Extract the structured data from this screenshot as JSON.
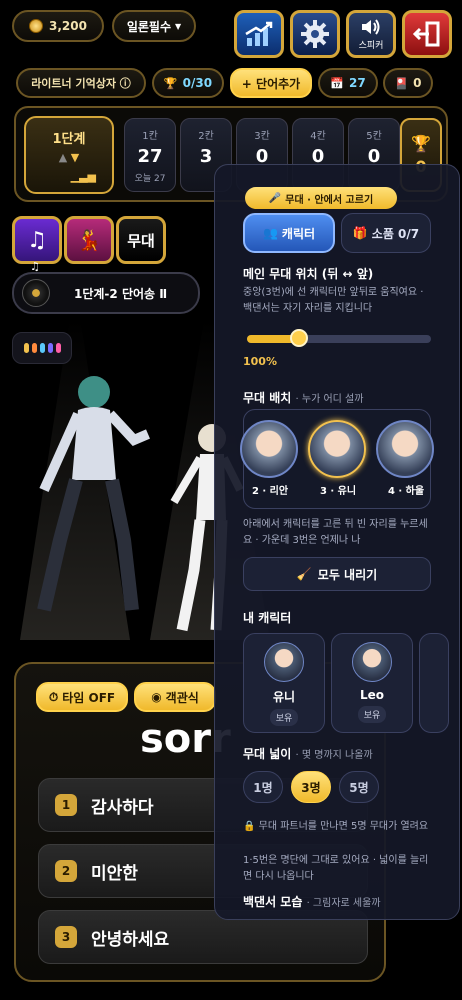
{
  "topbar": {
    "coins": "3,200",
    "mode": "일론필수",
    "speaker_label": "스피커"
  },
  "row2": {
    "memory_box": "라이트너 기억상자 ⓘ",
    "trophy_progress": "0/30",
    "add_word": "+ 단어추가",
    "calendar_count": "27",
    "cards_count": "0"
  },
  "level": {
    "title": "1단계",
    "cells": [
      {
        "head": "1칸",
        "value": "27",
        "sub": "오늘 27"
      },
      {
        "head": "2칸",
        "value": "3",
        "sub": ""
      },
      {
        "head": "3칸",
        "value": "0",
        "sub": ""
      },
      {
        "head": "4칸",
        "value": "0",
        "sub": ""
      },
      {
        "head": "5칸",
        "value": "0",
        "sub": ""
      }
    ],
    "trophy_value": "0"
  },
  "left_buttons": {
    "stage": "무대"
  },
  "song": {
    "name": "1단계-2 단어송 Ⅱ"
  },
  "quiz": {
    "timer": "타임 OFF",
    "objective": "객관식",
    "word": "sorr",
    "options": [
      {
        "num": "1",
        "text": "감사하다"
      },
      {
        "num": "2",
        "text": "미안한"
      },
      {
        "num": "3",
        "text": "안녕하세요"
      }
    ]
  },
  "drawer": {
    "title": "무대 · 안에서 고르기",
    "tab_character": "캐릭터",
    "tab_props": "소품 0/7",
    "main_pos_title": "메인 무대 위치 (뒤 ↔ 앞)",
    "main_pos_desc": "중앙(3번)에 선 캐릭터만 앞뒤로 움직여요 · 백댄서는 자기 자리를 지킵니다",
    "main_pos_value": 100,
    "main_pos_label": "100%",
    "placement_title": "무대 배치",
    "placement_sub": "· 누가 어디 설까",
    "slots": [
      {
        "label": "2 · 리안",
        "selected": false
      },
      {
        "label": "3 · 유니",
        "selected": true
      },
      {
        "label": "4 · 하울",
        "selected": false
      }
    ],
    "placement_desc": "아래에서 캐릭터를 고른 뒤 빈 자리를 누르세요 · 가운데 3번은 언제나 나",
    "clear_all": "모두 내리기",
    "my_chars_title": "내 캐릭터",
    "my_chars": [
      {
        "name": "유니",
        "tag": "보유"
      },
      {
        "name": "Leo",
        "tag": "보유"
      }
    ],
    "width_title": "무대 넓이",
    "width_sub": "· 몇 명까지 나올까",
    "width_options": [
      "1명",
      "3명",
      "5명"
    ],
    "width_selected": "3명",
    "lock_desc": "🔒 무대 파트너를 만나면 5명 무대가 열려요",
    "note_desc": "1·5번은 명단에 그대로 있어요 · 넓이를 늘리면 다시 나옵니다",
    "dancer_title": "백댄서 모습",
    "dancer_sub": "· 그림자로 세울까"
  },
  "colors": {
    "gold": "#f0b92b",
    "blue": "#2457b8"
  }
}
